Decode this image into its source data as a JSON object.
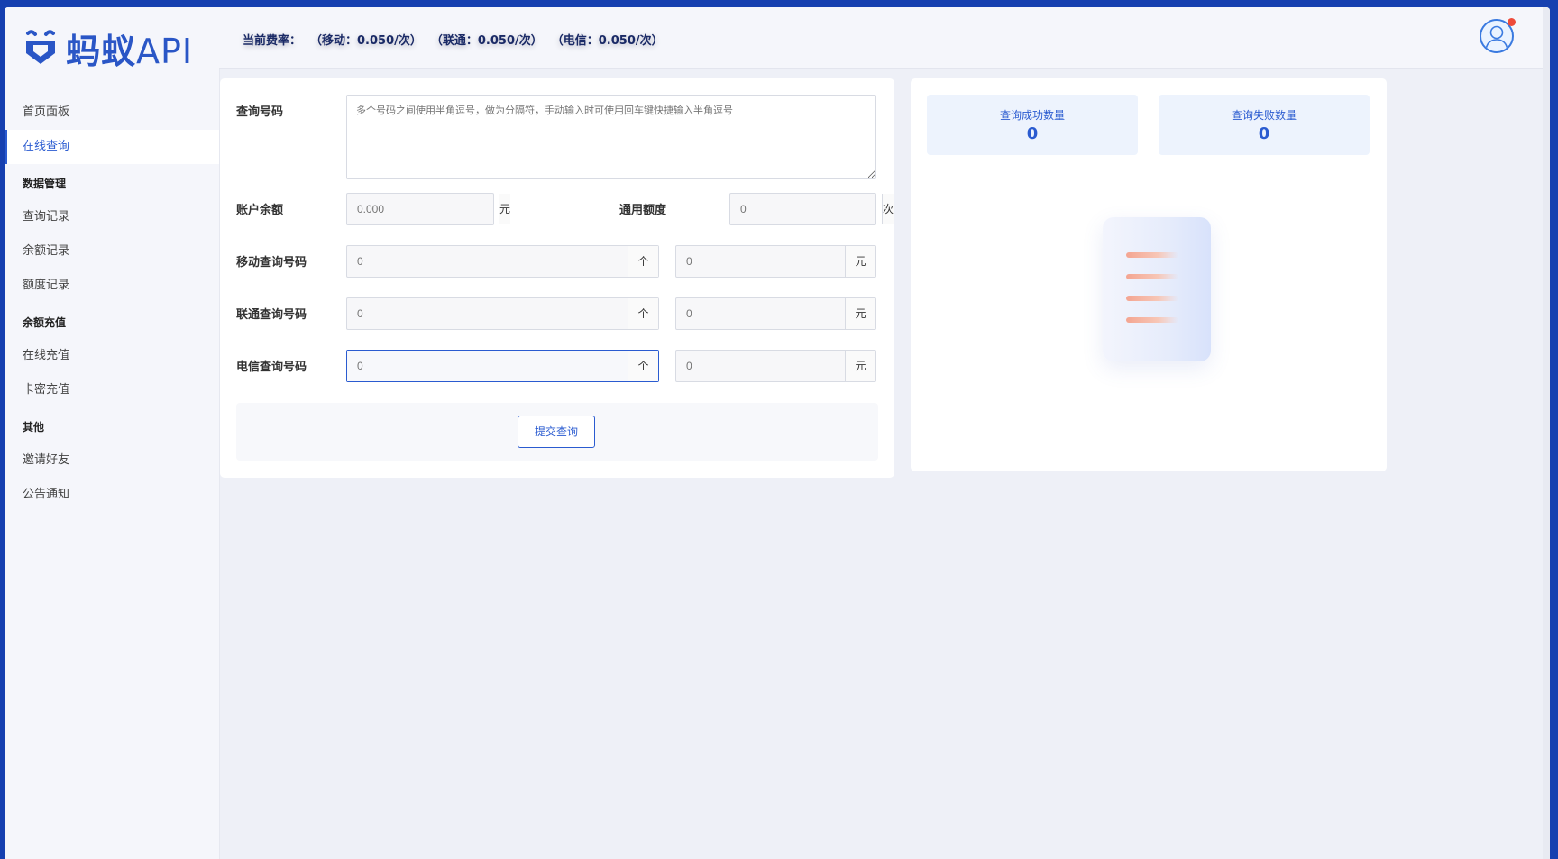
{
  "brand": {
    "cn": "蚂蚁",
    "api": "API",
    "accent": "#2a5bd0"
  },
  "sidebar": {
    "items": [
      {
        "kind": "item",
        "label": "首页面板",
        "active": false
      },
      {
        "kind": "item",
        "label": "在线查询",
        "active": true
      },
      {
        "kind": "group",
        "label": "数据管理"
      },
      {
        "kind": "item",
        "label": "查询记录",
        "active": false
      },
      {
        "kind": "item",
        "label": "余额记录",
        "active": false
      },
      {
        "kind": "item",
        "label": "额度记录",
        "active": false
      },
      {
        "kind": "group",
        "label": "余额充值"
      },
      {
        "kind": "item",
        "label": "在线充值",
        "active": false
      },
      {
        "kind": "item",
        "label": "卡密充值",
        "active": false
      },
      {
        "kind": "group",
        "label": "其他"
      },
      {
        "kind": "item",
        "label": "邀请好友",
        "active": false
      },
      {
        "kind": "item",
        "label": "公告通知",
        "active": false
      }
    ]
  },
  "header": {
    "rate_label": "当前费率：",
    "rates": [
      "（移动：0.050/次）",
      "（联通：0.050/次）",
      "（电信：0.050/次）"
    ]
  },
  "form": {
    "query_label": "查询号码",
    "query_placeholder": "多个号码之间使用半角逗号，做为分隔符，手动输入时可使用回车键快捷输入半角逗号",
    "balance_label": "账户余额",
    "balance_value": "0.000",
    "balance_unit": "元",
    "quota_label": "通用额度",
    "quota_value": "0",
    "quota_unit": "次",
    "rows": [
      {
        "label": "移动查询号码",
        "count": "0",
        "count_unit": "个",
        "cost": "0",
        "cost_unit": "元"
      },
      {
        "label": "联通查询号码",
        "count": "0",
        "count_unit": "个",
        "cost": "0",
        "cost_unit": "元"
      },
      {
        "label": "电信查询号码",
        "count": "0",
        "count_unit": "个",
        "cost": "0",
        "cost_unit": "元"
      }
    ],
    "submit_label": "提交查询"
  },
  "stats": {
    "success_label": "查询成功数量",
    "success_value": "0",
    "fail_label": "查询失败数量",
    "fail_value": "0"
  },
  "icons": [
    "ant-logo-icon",
    "user-avatar-icon",
    "notification-dot-icon",
    "empty-document-icon"
  ]
}
